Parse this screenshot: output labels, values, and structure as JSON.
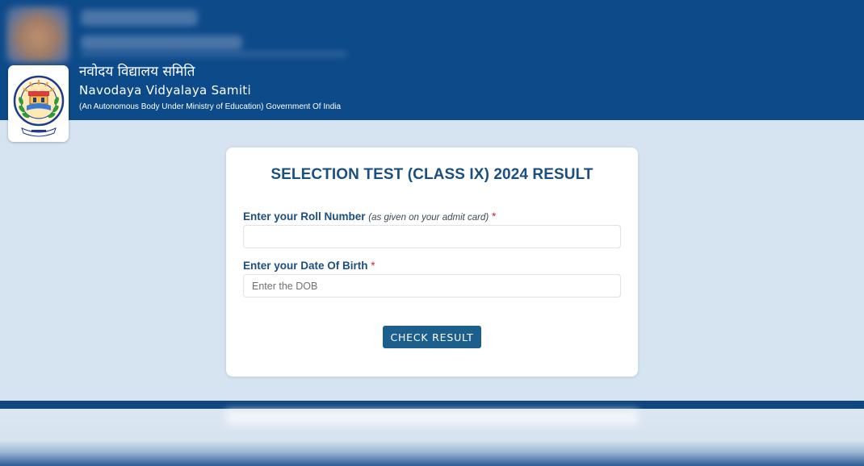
{
  "header": {
    "org_name_hindi": "नवोदय विद्यालय समिति",
    "org_name_english": "Navodaya Vidyalaya Samiti",
    "org_subtitle": "(An Autonomous Body Under Ministry of Education) Government Of India",
    "logo_icon": "nvs-emblem-icon",
    "bg_color": "#0d4a8a"
  },
  "form": {
    "title": "SELECTION TEST (CLASS IX) 2024 RESULT",
    "roll_number": {
      "label": "Enter your Roll Number",
      "hint": "(as given on your admit card)",
      "required_mark": "*",
      "value": "",
      "placeholder": ""
    },
    "dob": {
      "label": "Enter your Date Of Birth",
      "required_mark": "*",
      "value": "",
      "placeholder": "Enter the DOB"
    },
    "submit_label": "CHECK RESULT",
    "accent_color": "#1c5f8c",
    "title_color": "#1b4f7f",
    "required_color": "#d0263a"
  },
  "page": {
    "background_color": "#d6e4f2",
    "footer_band_color": "#0f4680"
  }
}
